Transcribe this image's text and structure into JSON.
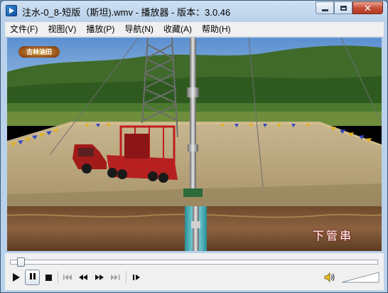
{
  "window": {
    "title": "注水-0_8-短版（斯坦).wmv - 播放器 - 版本：3.0.46"
  },
  "menu": [
    {
      "label": "文件(F)"
    },
    {
      "label": "视图(V)"
    },
    {
      "label": "播放(P)"
    },
    {
      "label": "导航(N)"
    },
    {
      "label": "收藏(A)"
    },
    {
      "label": "帮助(H)"
    }
  ],
  "video": {
    "caption": "下管串",
    "logo_text": "吉林油田"
  },
  "playback": {
    "position_fraction": 0.02
  },
  "controls": {
    "play_icon": "play-icon",
    "pause_icon": "pause-icon",
    "stop_icon": "stop-icon",
    "prev_icon": "skip-back-icon",
    "rewind_icon": "rewind-icon",
    "forward_icon": "fast-forward-icon",
    "next_icon": "skip-forward-icon",
    "step_icon": "frame-step-icon",
    "volume_icon": "speaker-icon"
  }
}
